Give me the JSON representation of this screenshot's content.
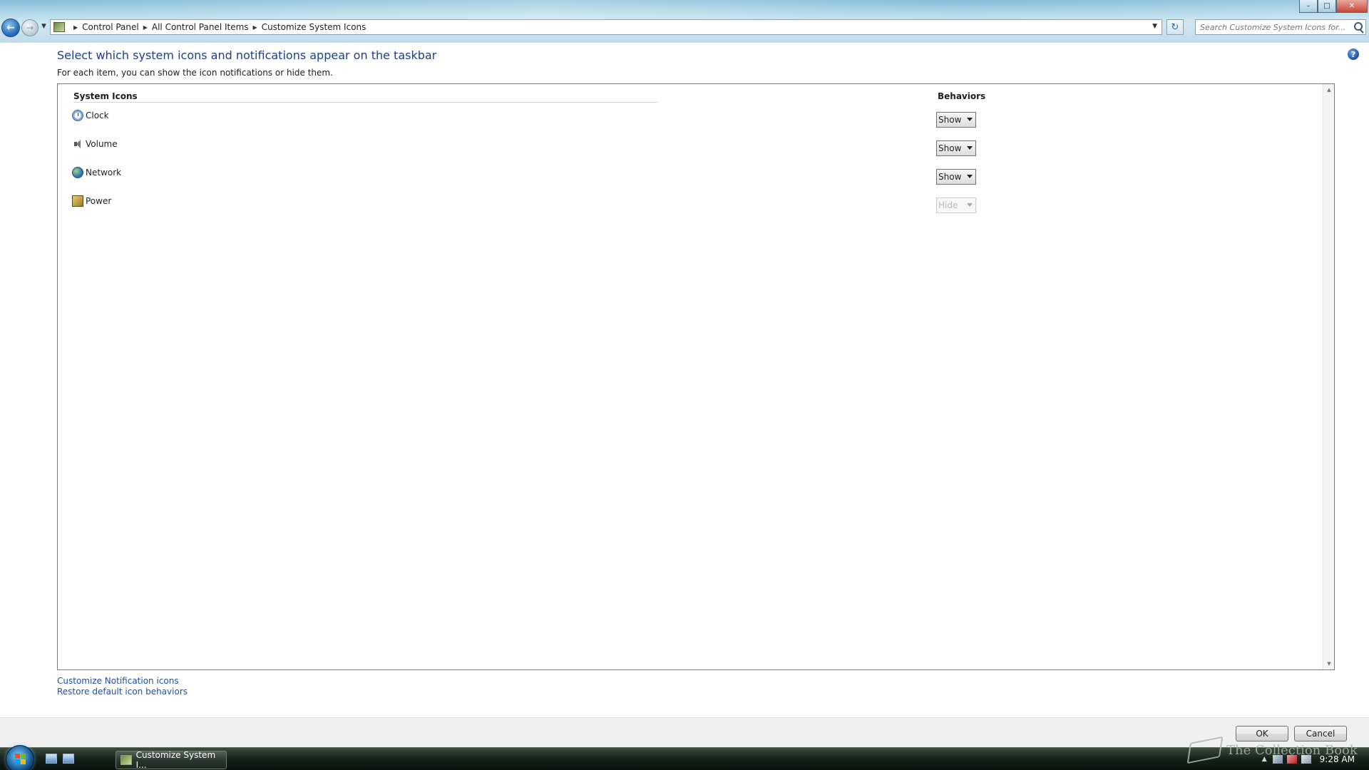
{
  "window": {
    "minimize": "–",
    "maximize": "□",
    "close": "✕"
  },
  "nav": {
    "back": "←",
    "forward": "→",
    "history": "▼",
    "breadcrumbs": [
      "Control Panel",
      "All Control Panel Items",
      "Customize System Icons"
    ],
    "address_dropdown": "▼",
    "refresh": "↻",
    "search_placeholder": "Search Customize System Icons for..."
  },
  "content": {
    "heading": "Select which system icons and notifications appear on the taskbar",
    "subheading": "For each item, you can show the icon notifications or hide them.",
    "help": "?",
    "column_icons": "System Icons",
    "column_behaviors": "Behaviors",
    "items": [
      {
        "label": "Clock",
        "icon": "clock-icon",
        "behavior": "Show",
        "disabled": false
      },
      {
        "label": "Volume",
        "icon": "volume-icon",
        "behavior": "Show",
        "disabled": false
      },
      {
        "label": "Network",
        "icon": "network-icon",
        "behavior": "Show",
        "disabled": false
      },
      {
        "label": "Power",
        "icon": "power-icon",
        "behavior": "Hide",
        "disabled": true
      }
    ],
    "behavior_options": [
      "Show",
      "Hide"
    ]
  },
  "links": {
    "customize_notifications": "Customize Notification icons",
    "restore_defaults": "Restore default icon behaviors"
  },
  "buttons": {
    "ok": "OK",
    "cancel": "Cancel"
  },
  "taskbar": {
    "task_label": "Customize System I...",
    "time": "9:28 AM",
    "watermark": "The Collection Book"
  },
  "colors": {
    "heading": "#1e3d8f",
    "link": "#1e4fa8",
    "taskbar": "#16211b"
  }
}
